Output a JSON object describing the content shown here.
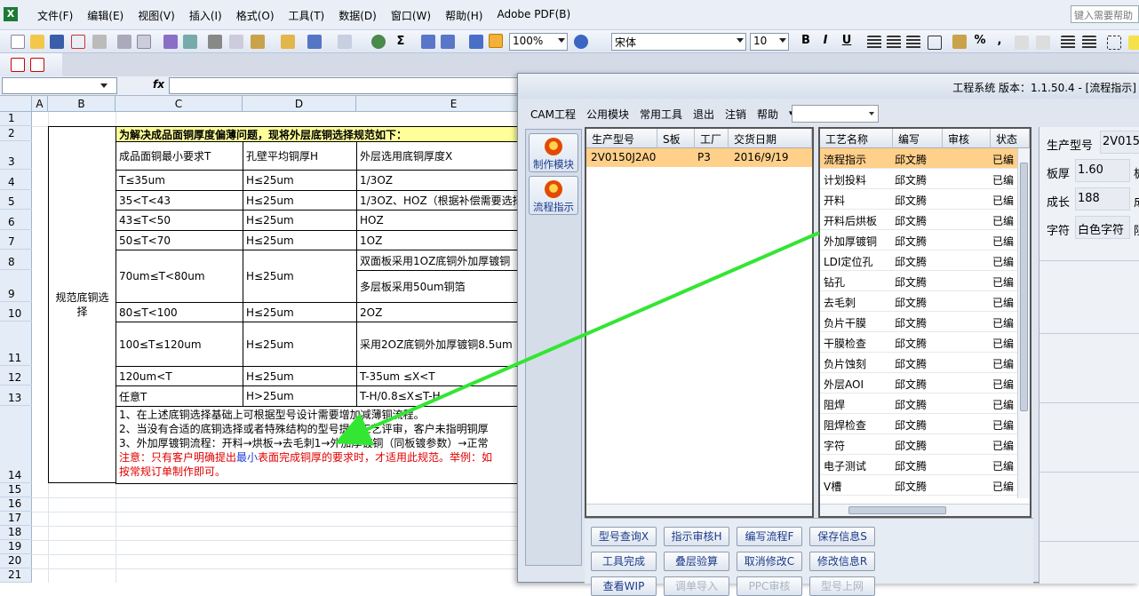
{
  "excel": {
    "menus": [
      "文件(F)",
      "编辑(E)",
      "视图(V)",
      "插入(I)",
      "格式(O)",
      "工具(T)",
      "数据(D)",
      "窗口(W)",
      "帮助(H)",
      "Adobe PDF(B)"
    ],
    "help_placeholder": "键入需要帮助",
    "zoom": "100%",
    "font_name": "宋体",
    "font_size": "10",
    "fx": "fx",
    "bold": "B",
    "italic": "I",
    "underline": "U",
    "percent": "%",
    "comma": ","
  },
  "columns": [
    "A",
    "B",
    "C",
    "D",
    "E"
  ],
  "rows": [
    "1",
    "2",
    "3",
    "4",
    "5",
    "6",
    "7",
    "8",
    "9",
    "10",
    "11",
    "12",
    "13",
    "14",
    "15",
    "16",
    "17",
    "18",
    "19",
    "20",
    "21"
  ],
  "table": {
    "intro": "为解决成品面铜厚度偏薄问题，现将外层底铜选择规范如下：",
    "category": "规范底铜选择",
    "headers": [
      "成品面铜最小要求T",
      "孔壁平均铜厚H",
      "外层选用底铜厚度X"
    ],
    "rows": [
      [
        "T≤35um",
        "H≤25um",
        "1/3OZ"
      ],
      [
        "35<T<43",
        "H≤25um",
        "1/3OZ、HOZ（根据补偿需要选择"
      ],
      [
        "43≤T<50",
        "H≤25um",
        "HOZ"
      ],
      [
        "50≤T<70",
        "H≤25um",
        "1OZ"
      ],
      [
        "70um≤T<80um",
        "H≤25um",
        "双面板采用1OZ底铜外加厚镀铜"
      ],
      [
        "",
        "",
        "多层板采用50um铜箔"
      ],
      [
        "80≤T<100",
        "H≤25um",
        "2OZ"
      ],
      [
        "100≤T≤120um",
        "H≤25um",
        "采用2OZ底铜外加厚镀铜8.5um"
      ],
      [
        "120um<T",
        "H≤25um",
        "T-35um ≤X<T"
      ],
      [
        "任意T",
        "H>25um",
        "T-H/0.8≤X≤T-H"
      ]
    ],
    "notes": [
      "1、在上述底铜选择基础上可根据型号设计需要增加减薄铜流程。",
      "2、当没有合适的底铜选择或者特殊结构的型号提交工艺评审，客户未指明铜厚",
      "3、外加厚镀铜流程：开料→烘板→去毛刺1→外加厚镀铜（同板镀参数）→正常"
    ],
    "note_red_a": "注意：只有客户明确提出",
    "note_blue": "最小",
    "note_red_b": "表面完成铜厚的要求时，才适用此规范。举例：如",
    "note_red_c": "按常规订单制作即可。"
  },
  "cam": {
    "title": "工程系统  版本：1.1.50.4 - [流程指示]",
    "menus": [
      "CAM工程",
      "公用模块",
      "常用工具",
      "退出",
      "注销",
      "帮助"
    ],
    "nav": [
      "制作模块",
      "流程指示"
    ],
    "order_headers": [
      "生产型号",
      "S板",
      "工厂",
      "交货日期"
    ],
    "order": {
      "model": "2V0150J2A0",
      "s": "",
      "factory": "P3",
      "date": "2016/9/19"
    },
    "proc_headers": [
      "工艺名称",
      "编写",
      "审核",
      "状态"
    ],
    "processes": [
      {
        "name": "流程指示",
        "author": "邱文腾",
        "status": "已编"
      },
      {
        "name": "计划投料",
        "author": "邱文腾",
        "status": "已编"
      },
      {
        "name": "开料",
        "author": "邱文腾",
        "status": "已编"
      },
      {
        "name": "开料后烘板",
        "author": "邱文腾",
        "status": "已编"
      },
      {
        "name": "外加厚镀铜",
        "author": "邱文腾",
        "status": "已编"
      },
      {
        "name": "LDI定位孔",
        "author": "邱文腾",
        "status": "已编"
      },
      {
        "name": "钻孔",
        "author": "邱文腾",
        "status": "已编"
      },
      {
        "name": "去毛刺",
        "author": "邱文腾",
        "status": "已编"
      },
      {
        "name": "负片干膜",
        "author": "邱文腾",
        "status": "已编"
      },
      {
        "name": "干膜检查",
        "author": "邱文腾",
        "status": "已编"
      },
      {
        "name": "负片蚀刻",
        "author": "邱文腾",
        "status": "已编"
      },
      {
        "name": "外层AOI",
        "author": "邱文腾",
        "status": "已编"
      },
      {
        "name": "阻焊",
        "author": "邱文腾",
        "status": "已编"
      },
      {
        "name": "阻焊检查",
        "author": "邱文腾",
        "status": "已编"
      },
      {
        "name": "字符",
        "author": "邱文腾",
        "status": "已编"
      },
      {
        "name": "电子测试",
        "author": "邱文腾",
        "status": "已编"
      },
      {
        "name": "V槽",
        "author": "邱文腾",
        "status": "已编"
      }
    ],
    "buttons_row1": [
      "型号查询X",
      "指示审核H",
      "编写流程F",
      "保存信息S"
    ],
    "buttons_row2": [
      "工具完成",
      "叠层验算",
      "取消修改C",
      "修改信息R"
    ],
    "buttons_row3": [
      "查看WIP",
      "调单导入",
      "PPC审核",
      "型号上网"
    ],
    "fields": {
      "model_label": "生产型号",
      "model": "2V015",
      "thick_label": "板厚",
      "thick": "1.60",
      "thick_unit": "板",
      "len_label": "成长",
      "len": "188",
      "len_unit": "成",
      "char_label": "字符",
      "char": "白色字符",
      "char_unit": "阻"
    }
  },
  "colors": {
    "accent_yellow": "#ffff99",
    "selected": "#ffd08a",
    "arrow": "#32e632",
    "red": "#e00000",
    "blue": "#1f3fd8"
  }
}
